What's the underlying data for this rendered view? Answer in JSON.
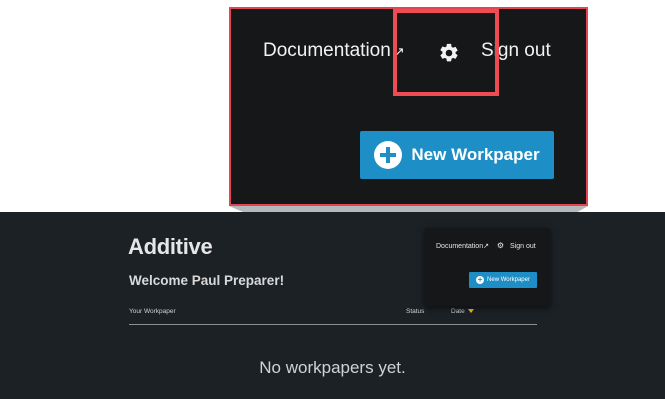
{
  "app": {
    "logo": "Additive",
    "welcome": "Welcome Paul Preparer!",
    "table": {
      "columns": [
        "Your Workpaper",
        "Status",
        "Date"
      ]
    },
    "empty_message": "No workpapers yet."
  },
  "header": {
    "documentation_label": "Documentation",
    "documentation_icon": "external-link-icon",
    "settings_icon": "gear-icon",
    "signout_label": "Sign out",
    "new_workpaper_label": "New Workpaper"
  },
  "colors": {
    "background": "#1c2126",
    "panel": "#151719",
    "accent": "#1e8fc6",
    "highlight": "#ef4b52",
    "sort_caret": "#f0c419"
  }
}
